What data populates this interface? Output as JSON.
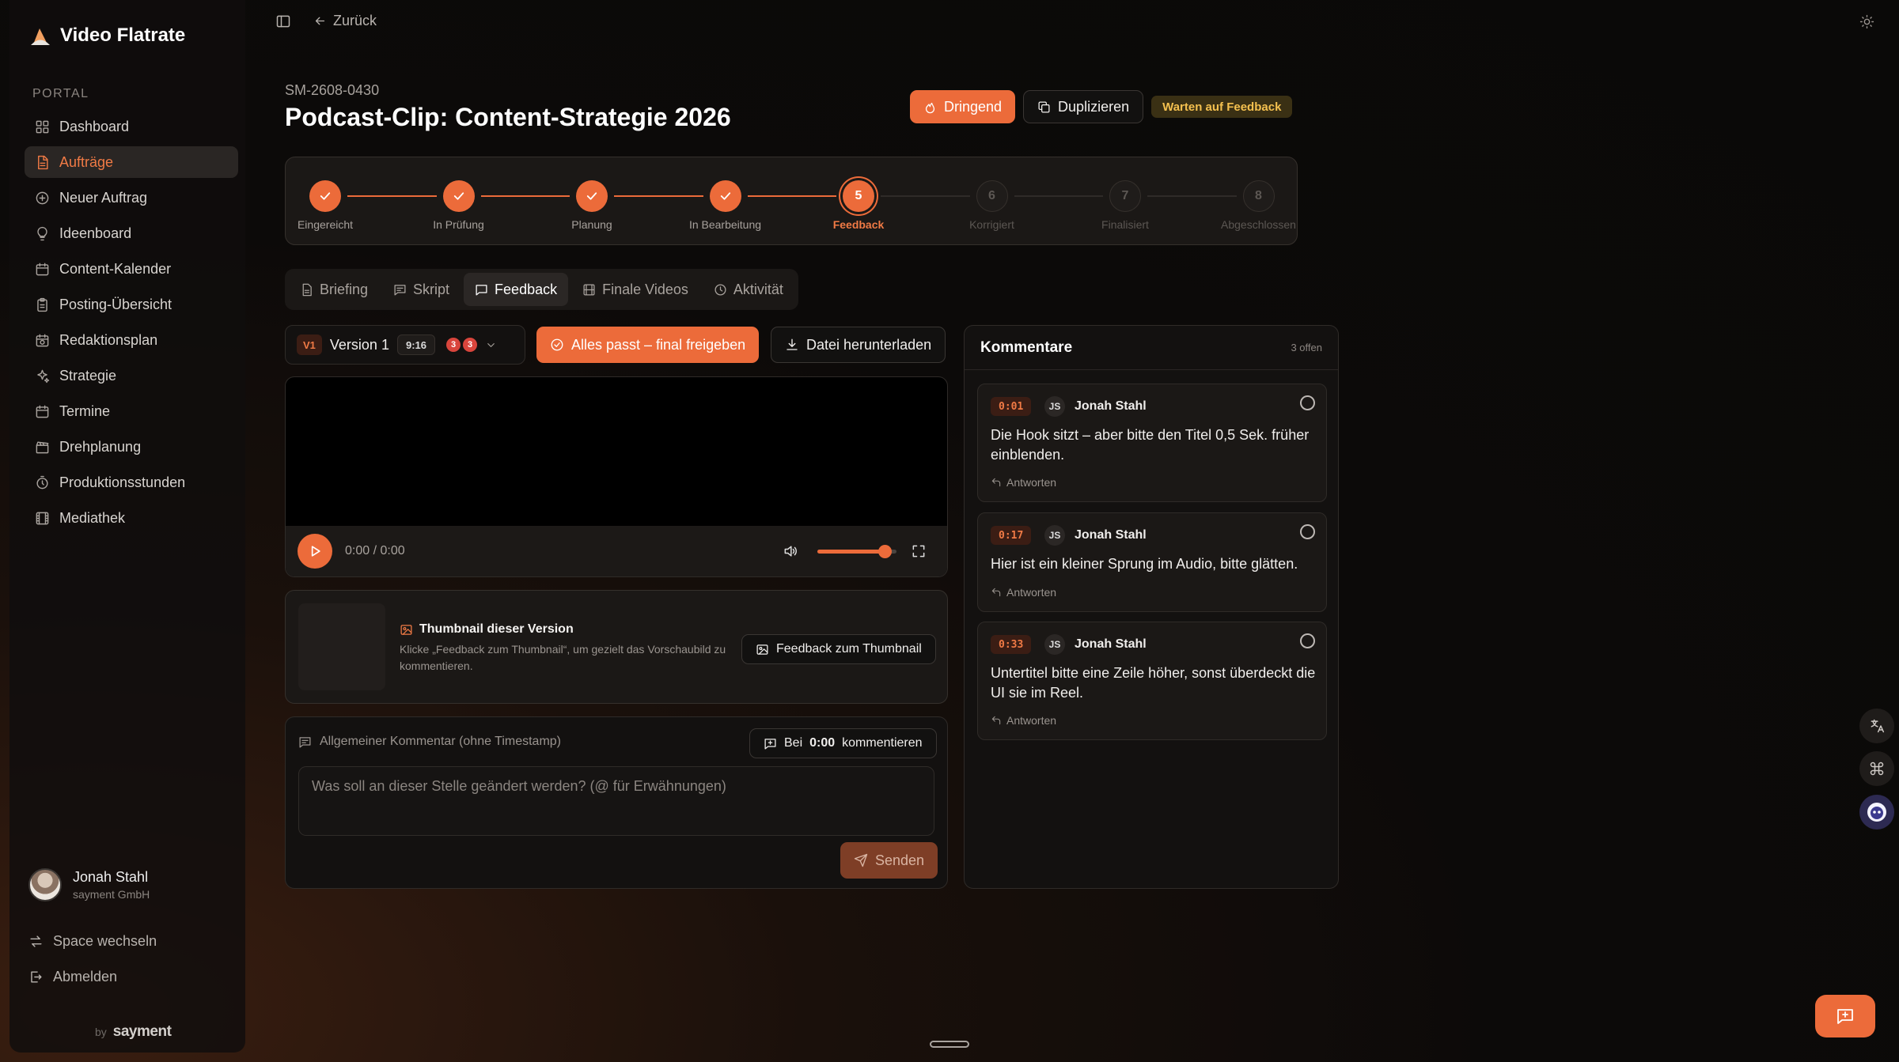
{
  "brand": {
    "title": "Video Flatrate"
  },
  "sidebar": {
    "section": "PORTAL",
    "items": [
      {
        "label": "Dashboard",
        "icon": "grid-icon"
      },
      {
        "label": "Aufträge",
        "icon": "document-icon",
        "active": true
      },
      {
        "label": "Neuer Auftrag",
        "icon": "plus-circle-icon"
      },
      {
        "label": "Ideenboard",
        "icon": "lightbulb-icon"
      },
      {
        "label": "Content-Kalender",
        "icon": "calendar-icon"
      },
      {
        "label": "Posting-Übersicht",
        "icon": "clipboard-icon"
      },
      {
        "label": "Redaktionsplan",
        "icon": "calendar-clock-icon"
      },
      {
        "label": "Strategie",
        "icon": "sparkles-icon"
      },
      {
        "label": "Termine",
        "icon": "calendar-icon"
      },
      {
        "label": "Drehplanung",
        "icon": "clapperboard-icon"
      },
      {
        "label": "Produktionsstunden",
        "icon": "timer-icon"
      },
      {
        "label": "Mediathek",
        "icon": "film-icon"
      }
    ],
    "user": {
      "name": "Jonah Stahl",
      "org": "sayment GmbH"
    },
    "switch_space": "Space wechseln",
    "logout": "Abmelden",
    "footer_by": "by",
    "footer_brand": "sayment"
  },
  "topbar": {
    "back_label": "Zurück"
  },
  "header": {
    "order_id": "SM-2608-0430",
    "title": "Podcast-Clip: Content-Strategie 2026",
    "urgent_label": "Dringend",
    "duplicate_label": "Duplizieren",
    "status_badge": "Warten auf Feedback"
  },
  "stepper": {
    "steps": [
      {
        "label": "Eingereicht",
        "num": "1",
        "state": "done"
      },
      {
        "label": "In Prüfung",
        "num": "2",
        "state": "done"
      },
      {
        "label": "Planung",
        "num": "3",
        "state": "done"
      },
      {
        "label": "In Bearbeitung",
        "num": "4",
        "state": "done"
      },
      {
        "label": "Feedback",
        "num": "5",
        "state": "current"
      },
      {
        "label": "Korrigiert",
        "num": "6",
        "state": "todo"
      },
      {
        "label": "Finalisiert",
        "num": "7",
        "state": "todo"
      },
      {
        "label": "Abgeschlossen",
        "num": "8",
        "state": "todo"
      }
    ]
  },
  "tabs": [
    {
      "label": "Briefing"
    },
    {
      "label": "Skript"
    },
    {
      "label": "Feedback",
      "active": true
    },
    {
      "label": "Finale Videos"
    },
    {
      "label": "Aktivität"
    }
  ],
  "player": {
    "version_tag": "V1",
    "version_name": "Version 1",
    "ratio": "9:16",
    "count_a": "3",
    "count_b": "3",
    "approve_label": "Alles passt – final freigeben",
    "download_label": "Datei herunterladen",
    "time": "0:00 / 0:00",
    "volume": 0.85
  },
  "thumbnail": {
    "title": "Thumbnail dieser Version",
    "desc": "Klicke „Feedback zum Thumbnail“, um gezielt das Vorschaubild zu kommentieren.",
    "button": "Feedback zum Thumbnail"
  },
  "comment_box": {
    "label": "Allgemeiner Kommentar (ohne Timestamp)",
    "ts_prefix": "Bei",
    "ts_time": "0:00",
    "ts_suffix": "kommentieren",
    "placeholder": "Was soll an dieser Stelle geändert werden? (@ für Erwähnungen)",
    "send_label": "Senden"
  },
  "comments": {
    "title": "Kommentare",
    "count": "3 offen",
    "reply_label": "Antworten",
    "items": [
      {
        "ts": "0:01",
        "initials": "JS",
        "author": "Jonah Stahl",
        "text": "Die Hook sitzt – aber bitte den Titel 0,5 Sek. früher einblenden."
      },
      {
        "ts": "0:17",
        "initials": "JS",
        "author": "Jonah Stahl",
        "text": "Hier ist ein kleiner Sprung im Audio, bitte glätten."
      },
      {
        "ts": "0:33",
        "initials": "JS",
        "author": "Jonah Stahl",
        "text": "Untertitel bitte eine Zeile höher, sonst überdeckt die UI sie im Reel."
      }
    ]
  },
  "colors": {
    "accent": "#ec6b3a",
    "status_yellow": "#f4c04f",
    "background": "#0c0a09"
  }
}
